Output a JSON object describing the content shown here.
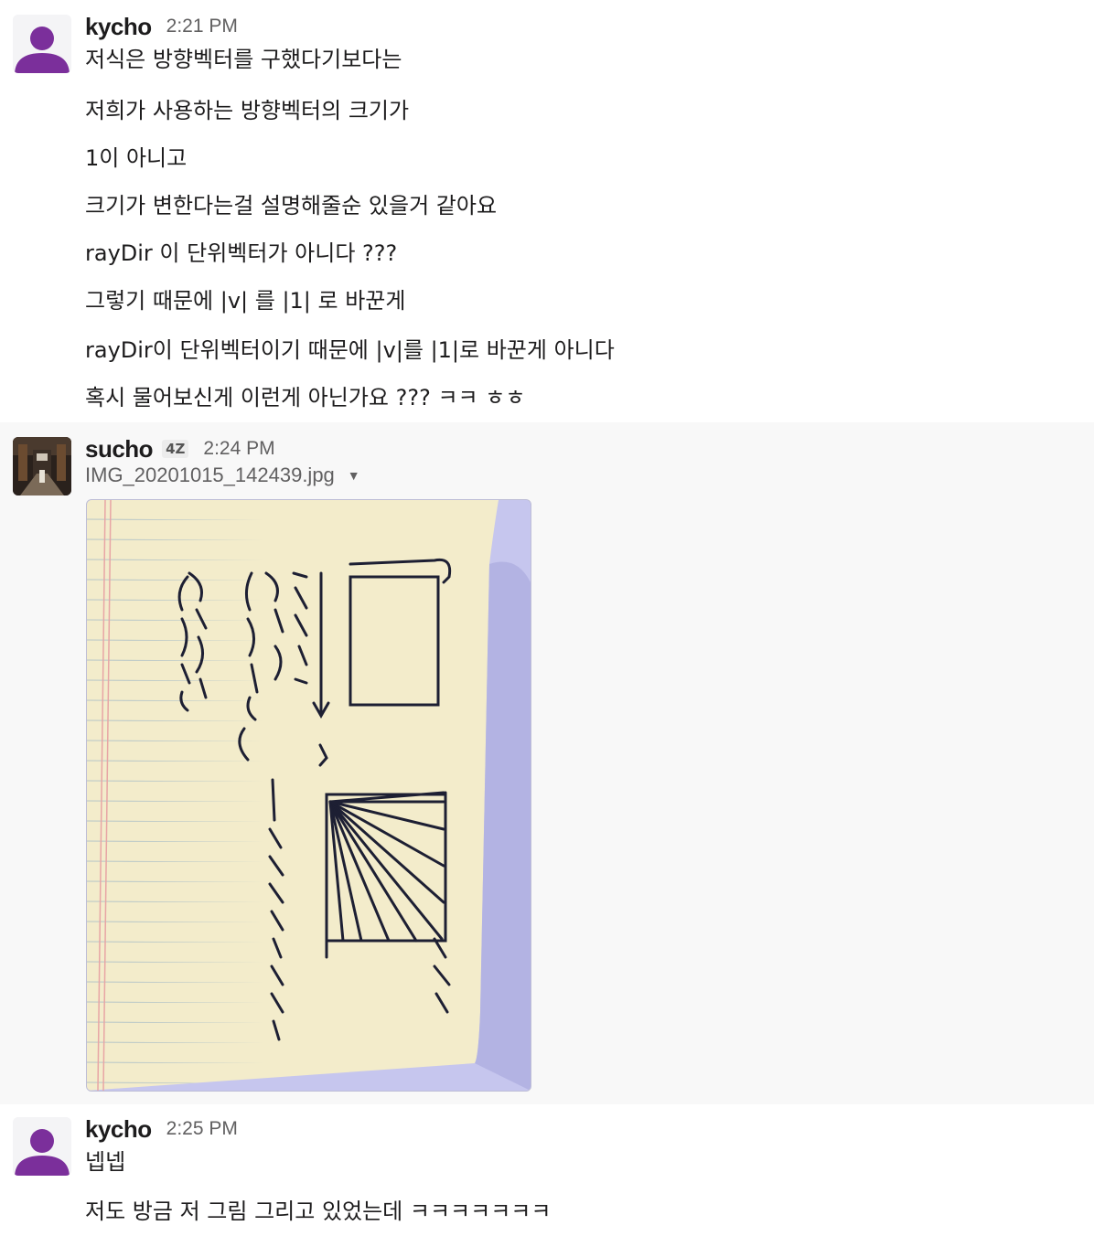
{
  "messages": [
    {
      "user": "kycho",
      "time": "2:21 PM",
      "lines": [
        "저식은 방향벡터를 구했다기보다는",
        "저희가 사용하는 방향벡터의 크기가",
        "1이 아니고",
        "크기가 변한다는걸 설명해줄순 있을거 같아요",
        "rayDir 이 단위벡터가 아니다 ???",
        "그렇기 때문에  |v| 를 |1| 로 바꾼게",
        "rayDir이 단위벡터이기 때문에   |v|를 |1|로 바꾼게 아니다",
        "혹시 물어보신게 이런게 아닌가요 ??? ㅋㅋ ㅎㅎ"
      ]
    },
    {
      "user": "sucho",
      "badge": "4Z",
      "time": "2:24 PM",
      "file_name": "IMG_20201015_142439.jpg",
      "colors": {
        "paper": "#f3eccb",
        "rule": "#b9c7c8",
        "margin": "#e8a5a5",
        "ink": "#1d1f33",
        "background": "#c6c6ee"
      }
    },
    {
      "user": "kycho",
      "time": "2:25 PM",
      "lines": [
        "넵넵",
        "저도 방금 저 그림 그리고 있었는데 ㅋㅋㅋㅋㅋㅋㅋ"
      ]
    }
  ]
}
